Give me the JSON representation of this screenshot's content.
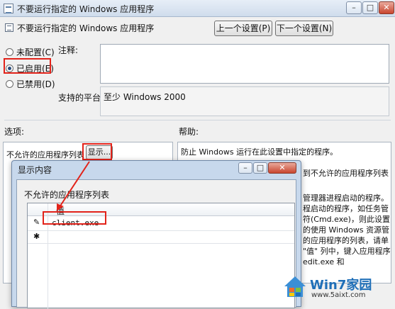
{
  "window": {
    "title": "不要运行指定的 Windows 应用程序",
    "minimize_glyph": "–",
    "maximize_glyph": "□",
    "close_glyph": "✕"
  },
  "header": {
    "policy_title": "不要运行指定的 Windows 应用程序",
    "prev_button": "上一个设置(P)",
    "next_button": "下一个设置(N)"
  },
  "state": {
    "options": [
      {
        "label": "未配置(C)",
        "selected": false
      },
      {
        "label": "已启用(E)",
        "selected": true
      },
      {
        "label": "已禁用(D)",
        "selected": false
      }
    ]
  },
  "comment_label": "注释:",
  "platform": {
    "label": "支持的平台:",
    "value": "至少 Windows 2000"
  },
  "sections": {
    "options_label": "选项:",
    "help_label": "帮助:"
  },
  "options_panel": {
    "list_label": "不允许的应用程序列表",
    "show_button": "显示..."
  },
  "help_panel": {
    "lines": [
      "防止 Windows 运行在此设置中指定的程序。",
      "到不允许的应用程序列表",
      "管理器进程启动的程序。",
      "程启动的程序，如任务管",
      "符(Cmd.exe)，则此设置",
      "的使用 Windows 资源管",
      "的应用程序的列表，请单",
      "\"值\" 列中，键入应用程序",
      "edit.exe 和"
    ]
  },
  "dialog": {
    "title": "显示内容",
    "list_label": "不允许的应用程序列表",
    "column_header": "值",
    "rows": [
      {
        "marker": "✎",
        "value": "client.exe"
      },
      {
        "marker": "✱",
        "value": ""
      }
    ]
  },
  "watermark": {
    "brand": "Win7家园",
    "url": "www.5aixt.com"
  },
  "colors": {
    "highlight": "#e2231a",
    "dialog_frame": "#c7d8ec"
  }
}
